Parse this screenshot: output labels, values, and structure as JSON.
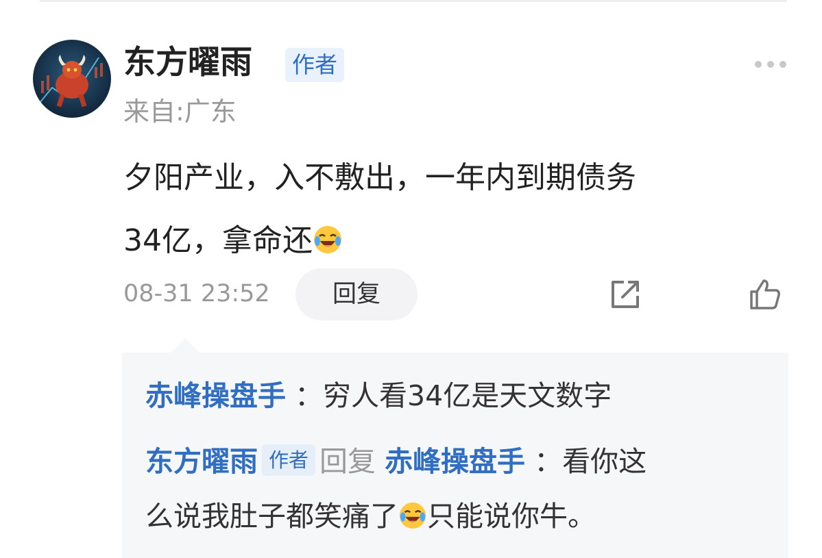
{
  "comment": {
    "author": "东方曜雨",
    "author_badge": "作者",
    "location": "来自:广东",
    "text_line1": "夕阳产业，入不敷出，一年内到期债务",
    "text_line2": "34亿，拿命还",
    "timestamp": "08-31 23:52",
    "reply_label": "回复"
  },
  "replies": [
    {
      "user": "赤峰操盘手",
      "separator": "：",
      "text": "穷人看34亿是天文数字"
    },
    {
      "user": "东方曜雨",
      "badge": "作者",
      "reply_word": "回复",
      "target": "赤峰操盘手",
      "separator": "：",
      "text_part1": "看你这",
      "text_part2": "么说我肚子都笑痛了",
      "text_part3": "只能说你牛。"
    }
  ],
  "icons": {
    "avatar": "bull-avatar",
    "emoji": "laughing-crying-emoji",
    "more": "more-icon",
    "share": "share-icon",
    "like": "thumbs-up-icon"
  },
  "colors": {
    "accent": "#2f6ec1",
    "muted": "#999999",
    "reply_bg": "#f6f7f9"
  }
}
